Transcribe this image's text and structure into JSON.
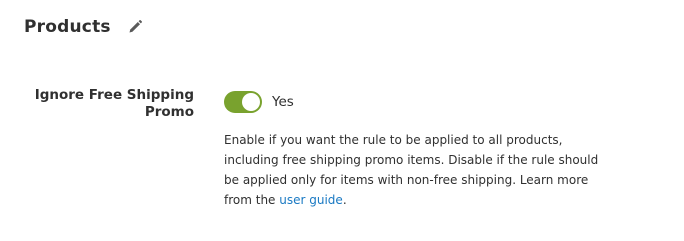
{
  "section": {
    "title": "Products",
    "edit_icon": "pencil-icon"
  },
  "field": {
    "label": "Ignore Free Shipping Promo",
    "toggle_state": "on",
    "toggle_value": "Yes",
    "toggle_color": "#79a22e",
    "note_text": "Enable if you want the rule to be applied to all products, including free shipping promo items. Disable if the rule should be applied only for items with non-free shipping. Learn more from the",
    "note_link": "user guide",
    "note_end": "."
  }
}
